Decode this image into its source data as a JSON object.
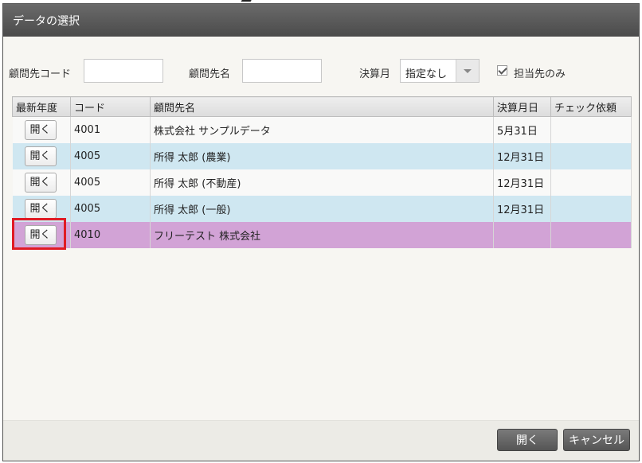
{
  "dialog": {
    "title": "データの選択"
  },
  "filters": {
    "client_code_label": "顧問先コード",
    "client_code_value": "",
    "client_name_label": "顧問先名",
    "client_name_value": "",
    "settlement_month_label": "決算月",
    "settlement_month_value": "指定なし",
    "assigned_only_label": "担当先のみ",
    "assigned_only_checked": true
  },
  "table": {
    "headers": [
      "最新年度",
      "コード",
      "顧問先名",
      "決算月日",
      "チェック依頼"
    ],
    "open_label": "開く",
    "rows": [
      {
        "code": "4001",
        "name": "株式会社 サンプルデータ",
        "date": "5月31日",
        "check": ""
      },
      {
        "code": "4005",
        "name": "所得 太郎 (農業)",
        "date": "12月31日",
        "check": ""
      },
      {
        "code": "4005",
        "name": "所得 太郎 (不動産)",
        "date": "12月31日",
        "check": ""
      },
      {
        "code": "4005",
        "name": "所得 太郎 (一般)",
        "date": "12月31日",
        "check": ""
      },
      {
        "code": "4010",
        "name": "フリーテスト 株式会社",
        "date": "",
        "check": ""
      }
    ]
  },
  "footer": {
    "open_label": "開く",
    "cancel_label": "キャンセル"
  },
  "colors": {
    "row_selected": "#d2a3d6",
    "row_alternate": "#cfe7f1",
    "highlight": "#e01b24"
  }
}
